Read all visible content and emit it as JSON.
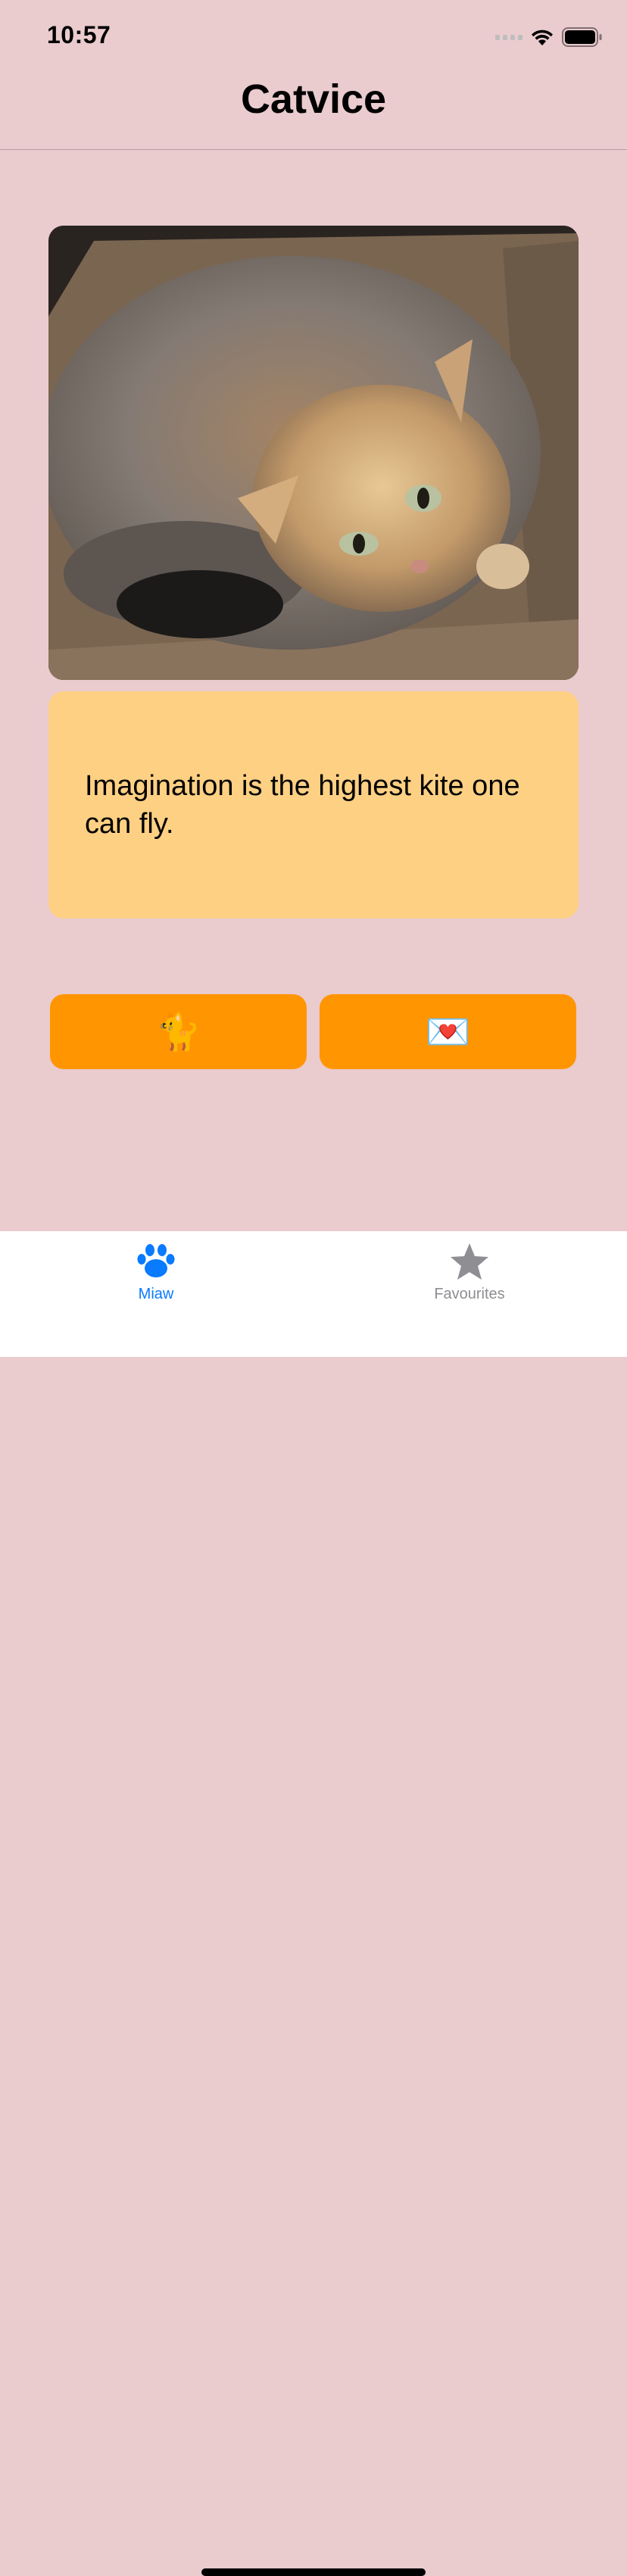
{
  "status_bar": {
    "time": "10:57"
  },
  "nav": {
    "title": "Catvice"
  },
  "advice": {
    "text": "Imagination is the highest kite one can fly."
  },
  "buttons": {
    "new_cat": "🐈",
    "love_letter": "💌"
  },
  "tabs": [
    {
      "label": "Miaw",
      "icon": "paw-icon",
      "selected": true
    },
    {
      "label": "Favourites",
      "icon": "star-icon",
      "selected": false
    }
  ],
  "colors": {
    "background": "#eacbce",
    "card": "#fdd083",
    "button": "#ff9500",
    "tab_active": "#0a7aff",
    "tab_inactive": "#8e8e93"
  }
}
